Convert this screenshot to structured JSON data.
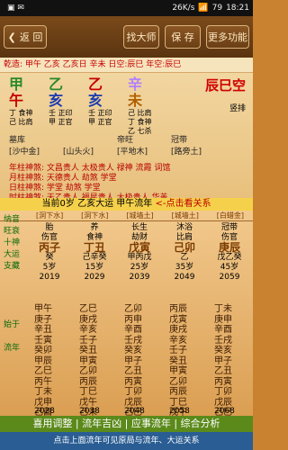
{
  "status": {
    "speed": "26K/s",
    "battery": "79",
    "time": "18:21"
  },
  "topbar": {
    "back": "返 回",
    "btn1": "找大师",
    "btn2": "保 存",
    "btn3": "更多功能"
  },
  "header": "乾造: 甲午 乙亥 乙亥日 辛未  日空:辰巳 年空:辰巳",
  "pillars": [
    {
      "gan": "甲",
      "zhi": "午",
      "gan_color": "#2a8a2a",
      "zhi_color": "#c40000",
      "hidden": [
        "丁 食神",
        "己 比肩"
      ]
    },
    {
      "gan": "乙",
      "zhi": "亥",
      "gan_color": "#2a8a2a",
      "zhi_color": "#1a3ab0",
      "hidden": [
        "壬 正印",
        "甲 正官"
      ]
    },
    {
      "gan": "乙",
      "zhi": "亥",
      "gan_color": "#c40000",
      "zhi_color": "#1a3ab0",
      "hidden": [
        "壬 正印",
        "甲 正官"
      ]
    },
    {
      "gan": "辛",
      "zhi": "未",
      "gan_color": "#b07fff",
      "zhi_color": "#b06000",
      "hidden": [
        "己 比肩",
        "丁 食神",
        "乙 七杀"
      ]
    }
  ],
  "kong": {
    "big": "辰巳空",
    "small": "竖排"
  },
  "nayin": {
    "row1": [
      "墓库",
      "",
      "帝旺",
      "冠带"
    ],
    "row2": [
      "[沙中金]",
      "[山头火]",
      "[平地木]",
      "[路旁土]"
    ]
  },
  "shensha": [
    "年柱神煞: 文昌贵人 太极贵人 禄神 流霞 词馆",
    "月柱神煞: 天德贵人 劫煞 学堂",
    "日柱神煞: 学堂 劫煞 学堂",
    "时柱神煞: 天乙贵人 福星贵人 太极贵人 华盖"
  ],
  "bar": {
    "left": "当前0岁 乙亥大运 甲午流年",
    "right": "<-点击看关系"
  },
  "dayun_cols": [
    "[洞下水]",
    "[洞下水]",
    "[城墙土]",
    "[城墙土]",
    "[白蜡金]"
  ],
  "dayun": [
    {
      "gz": "丙子",
      "top": "伤官",
      "zhang": "胎",
      "hide": "癸",
      "age": "5岁",
      "year": "2019"
    },
    {
      "gz": "丁丑",
      "top": "食神",
      "zhang": "养",
      "hide": "己辛癸",
      "age": "15岁",
      "year": "2029"
    },
    {
      "gz": "戊寅",
      "top": "劫财",
      "zhang": "长生",
      "hide": "甲丙戊",
      "age": "25岁",
      "year": "2039"
    },
    {
      "gz": "己卯",
      "top": "比肩",
      "zhang": "沐浴",
      "hide": "乙",
      "age": "35岁",
      "year": "2049"
    },
    {
      "gz": "庚辰",
      "top": "伤官",
      "zhang": "冠带",
      "hide": "戊乙癸",
      "age": "45岁",
      "year": "2059"
    }
  ],
  "left_labels": [
    "纳音",
    "旺衰",
    "十神",
    "大运",
    "支藏",
    "",
    "",
    "",
    "",
    "始于",
    "",
    "流年",
    "",
    "",
    "",
    "",
    "",
    "",
    "止于"
  ],
  "liunian": [
    [
      "甲午",
      "乙巳",
      "乙卯",
      "丙辰",
      "丁未"
    ],
    [
      "庚子",
      "庚戌",
      "丙申",
      "戊寅",
      "庚申"
    ],
    [
      "辛丑",
      "辛亥",
      "辛酉",
      "庚戌",
      "辛酉"
    ],
    [
      "壬寅",
      "壬子",
      "壬戌",
      "辛亥",
      "壬戌"
    ],
    [
      "癸卯",
      "癸丑",
      "癸亥",
      "壬子",
      "癸亥"
    ],
    [
      "甲辰",
      "甲寅",
      "甲子",
      "癸丑",
      "甲子"
    ],
    [
      "乙巳",
      "乙卯",
      "乙丑",
      "甲寅",
      "乙丑"
    ],
    [
      "丙午",
      "丙辰",
      "丙寅",
      "乙卯",
      "丙寅"
    ],
    [
      "丁未",
      "丁巳",
      "丁卯",
      "丙辰",
      "丁卯"
    ],
    [
      "戊申",
      "戊午",
      "戊辰",
      "丁巳",
      "戊辰"
    ],
    [
      "己酉",
      "己未",
      "己巳",
      "戊午",
      "己巳"
    ]
  ],
  "end_years": [
    "2028",
    "2038",
    "2048",
    "2058",
    "2068"
  ],
  "bottom": "喜用调整 | 流年吉凶 | 应事流年 | 综合分析",
  "hint": "点击上面流年可见原局与流年、大运关系"
}
